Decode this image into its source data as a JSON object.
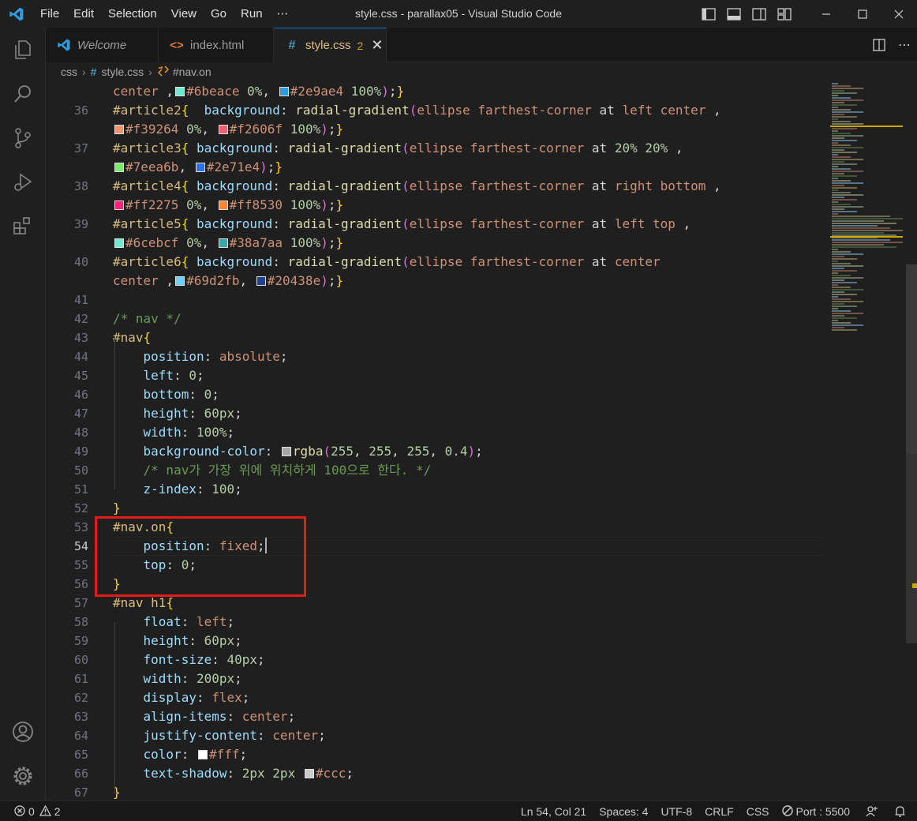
{
  "window": {
    "title": "style.css - parallax05 - Visual Studio Code",
    "menu": [
      "File",
      "Edit",
      "Selection",
      "View",
      "Go",
      "Run",
      "⋯"
    ]
  },
  "activity_icons": [
    "explorer-icon",
    "search-icon",
    "source-control-icon",
    "run-debug-icon",
    "extensions-icon",
    "account-icon",
    "settings-gear-icon"
  ],
  "tabs": [
    {
      "label": "Welcome",
      "icon": "vscode-logo-icon"
    },
    {
      "label": "index.html",
      "icon": "html-icon"
    },
    {
      "label": "style.css",
      "icon": "css-icon",
      "badge": "2",
      "active": true
    }
  ],
  "breadcrumb": {
    "folder": "css",
    "file": "style.css",
    "symbol": "#nav.on"
  },
  "lines": [
    {
      "n": "",
      "t": [
        [
          "val",
          "center"
        ],
        [
          "pun",
          " ,"
        ],
        [
          "sw",
          "#6beace"
        ],
        [
          "val",
          "#6beace"
        ],
        [
          "pun",
          " "
        ],
        [
          "num",
          "0%"
        ],
        [
          "pun",
          ", "
        ],
        [
          "sw",
          "#2e9ae4"
        ],
        [
          "val",
          "#2e9ae4"
        ],
        [
          "pun",
          " "
        ],
        [
          "num",
          "100%"
        ],
        [
          "br2",
          ")"
        ],
        [
          "pun",
          ";"
        ],
        [
          "br1",
          "}"
        ]
      ]
    },
    {
      "n": "36",
      "t": [
        [
          "sel",
          "#article2"
        ],
        [
          "br1",
          "{"
        ],
        [
          "pun",
          "  "
        ],
        [
          "prop",
          "background"
        ],
        [
          "pun",
          ": "
        ],
        [
          "fn",
          "radial-gradient"
        ],
        [
          "br2",
          "("
        ],
        [
          "val",
          "ellipse farthest-corner"
        ],
        [
          "pun",
          " at "
        ],
        [
          "val",
          "left center"
        ],
        [
          "pun",
          " ,"
        ]
      ]
    },
    {
      "n": "",
      "t": [
        [
          "sw",
          "#f39264"
        ],
        [
          "val",
          "#f39264"
        ],
        [
          "pun",
          " "
        ],
        [
          "num",
          "0%"
        ],
        [
          "pun",
          ", "
        ],
        [
          "sw",
          "#f2606f"
        ],
        [
          "val",
          "#f2606f"
        ],
        [
          "pun",
          " "
        ],
        [
          "num",
          "100%"
        ],
        [
          "br2",
          ")"
        ],
        [
          "pun",
          ";"
        ],
        [
          "br1",
          "}"
        ]
      ]
    },
    {
      "n": "37",
      "t": [
        [
          "sel",
          "#article3"
        ],
        [
          "br1",
          "{"
        ],
        [
          "pun",
          " "
        ],
        [
          "prop",
          "background"
        ],
        [
          "pun",
          ": "
        ],
        [
          "fn",
          "radial-gradient"
        ],
        [
          "br2",
          "("
        ],
        [
          "val",
          "ellipse farthest-corner"
        ],
        [
          "pun",
          " at "
        ],
        [
          "num",
          "20% 20%"
        ],
        [
          "pun",
          " ,"
        ]
      ]
    },
    {
      "n": "",
      "t": [
        [
          "sw",
          "#7eea6b"
        ],
        [
          "val",
          "#7eea6b"
        ],
        [
          "pun",
          ", "
        ],
        [
          "sw",
          "#2e71e4"
        ],
        [
          "val",
          "#2e71e4"
        ],
        [
          "br2",
          ")"
        ],
        [
          "pun",
          ";"
        ],
        [
          "br1",
          "}"
        ]
      ]
    },
    {
      "n": "38",
      "t": [
        [
          "sel",
          "#article4"
        ],
        [
          "br1",
          "{"
        ],
        [
          "pun",
          " "
        ],
        [
          "prop",
          "background"
        ],
        [
          "pun",
          ": "
        ],
        [
          "fn",
          "radial-gradient"
        ],
        [
          "br2",
          "("
        ],
        [
          "val",
          "ellipse farthest-corner"
        ],
        [
          "pun",
          " at "
        ],
        [
          "val",
          "right bottom"
        ],
        [
          "pun",
          " ,"
        ]
      ]
    },
    {
      "n": "",
      "t": [
        [
          "sw",
          "#ff2275"
        ],
        [
          "val",
          "#ff2275"
        ],
        [
          "pun",
          " "
        ],
        [
          "num",
          "0%"
        ],
        [
          "pun",
          ", "
        ],
        [
          "sw",
          "#ff8530"
        ],
        [
          "val",
          "#ff8530"
        ],
        [
          "pun",
          " "
        ],
        [
          "num",
          "100%"
        ],
        [
          "br2",
          ")"
        ],
        [
          "pun",
          ";"
        ],
        [
          "br1",
          "}"
        ]
      ]
    },
    {
      "n": "39",
      "t": [
        [
          "sel",
          "#article5"
        ],
        [
          "br1",
          "{"
        ],
        [
          "pun",
          " "
        ],
        [
          "prop",
          "background"
        ],
        [
          "pun",
          ": "
        ],
        [
          "fn",
          "radial-gradient"
        ],
        [
          "br2",
          "("
        ],
        [
          "val",
          "ellipse farthest-corner"
        ],
        [
          "pun",
          " at "
        ],
        [
          "val",
          "left top"
        ],
        [
          "pun",
          " ,"
        ]
      ]
    },
    {
      "n": "",
      "t": [
        [
          "sw",
          "#6cebcf"
        ],
        [
          "val",
          "#6cebcf"
        ],
        [
          "pun",
          " "
        ],
        [
          "num",
          "0%"
        ],
        [
          "pun",
          ", "
        ],
        [
          "sw",
          "#38a7aa"
        ],
        [
          "val",
          "#38a7aa"
        ],
        [
          "pun",
          " "
        ],
        [
          "num",
          "100%"
        ],
        [
          "br2",
          ")"
        ],
        [
          "pun",
          ";"
        ],
        [
          "br1",
          "}"
        ]
      ]
    },
    {
      "n": "40",
      "t": [
        [
          "sel",
          "#article6"
        ],
        [
          "br1",
          "{"
        ],
        [
          "pun",
          " "
        ],
        [
          "prop",
          "background"
        ],
        [
          "pun",
          ": "
        ],
        [
          "fn",
          "radial-gradient"
        ],
        [
          "br2",
          "("
        ],
        [
          "val",
          "ellipse farthest-corner"
        ],
        [
          "pun",
          " at "
        ],
        [
          "val",
          "center"
        ]
      ]
    },
    {
      "n": "",
      "t": [
        [
          "val",
          "center"
        ],
        [
          "pun",
          " ,"
        ],
        [
          "sw",
          "#69d2fb"
        ],
        [
          "val",
          "#69d2fb"
        ],
        [
          "pun",
          ", "
        ],
        [
          "sw",
          "#20438e"
        ],
        [
          "val",
          "#20438e"
        ],
        [
          "br2",
          ")"
        ],
        [
          "pun",
          ";"
        ],
        [
          "br1",
          "}"
        ]
      ]
    },
    {
      "n": "41",
      "t": []
    },
    {
      "n": "42",
      "t": [
        [
          "cmt",
          "/* nav */"
        ]
      ]
    },
    {
      "n": "43",
      "t": [
        [
          "sel",
          "#nav"
        ],
        [
          "br1",
          "{"
        ]
      ]
    },
    {
      "n": "44",
      "t": [
        [
          "pun",
          "    "
        ],
        [
          "prop",
          "position"
        ],
        [
          "pun",
          ": "
        ],
        [
          "val",
          "absolute"
        ],
        [
          "pun",
          ";"
        ]
      ]
    },
    {
      "n": "45",
      "t": [
        [
          "pun",
          "    "
        ],
        [
          "prop",
          "left"
        ],
        [
          "pun",
          ": "
        ],
        [
          "num",
          "0"
        ],
        [
          "pun",
          ";"
        ]
      ]
    },
    {
      "n": "46",
      "t": [
        [
          "pun",
          "    "
        ],
        [
          "prop",
          "bottom"
        ],
        [
          "pun",
          ": "
        ],
        [
          "num",
          "0"
        ],
        [
          "pun",
          ";"
        ]
      ]
    },
    {
      "n": "47",
      "t": [
        [
          "pun",
          "    "
        ],
        [
          "prop",
          "height"
        ],
        [
          "pun",
          ": "
        ],
        [
          "num",
          "60px"
        ],
        [
          "pun",
          ";"
        ]
      ]
    },
    {
      "n": "48",
      "t": [
        [
          "pun",
          "    "
        ],
        [
          "prop",
          "width"
        ],
        [
          "pun",
          ": "
        ],
        [
          "num",
          "100%"
        ],
        [
          "pun",
          ";"
        ]
      ]
    },
    {
      "n": "49",
      "t": [
        [
          "pun",
          "    "
        ],
        [
          "prop",
          "background-color"
        ],
        [
          "pun",
          ": "
        ],
        [
          "sw",
          "#a6a6a6"
        ],
        [
          "fn",
          "rgba"
        ],
        [
          "br2",
          "("
        ],
        [
          "num",
          "255"
        ],
        [
          "pun",
          ", "
        ],
        [
          "num",
          "255"
        ],
        [
          "pun",
          ", "
        ],
        [
          "num",
          "255"
        ],
        [
          "pun",
          ", "
        ],
        [
          "num",
          "0.4"
        ],
        [
          "br2",
          ")"
        ],
        [
          "pun",
          ";"
        ]
      ]
    },
    {
      "n": "50",
      "t": [
        [
          "pun",
          "    "
        ],
        [
          "cmt",
          "/* nav가 가장 위에 위치하게 100으로 한다. */"
        ]
      ]
    },
    {
      "n": "51",
      "t": [
        [
          "pun",
          "    "
        ],
        [
          "prop",
          "z-index"
        ],
        [
          "pun",
          ": "
        ],
        [
          "num",
          "100"
        ],
        [
          "pun",
          ";"
        ]
      ]
    },
    {
      "n": "52",
      "t": [
        [
          "br1",
          "}"
        ]
      ]
    },
    {
      "n": "53",
      "t": [
        [
          "sel",
          "#nav.on"
        ],
        [
          "br1",
          "{"
        ]
      ]
    },
    {
      "n": "54",
      "t": [
        [
          "pun",
          "    "
        ],
        [
          "prop",
          "position"
        ],
        [
          "pun",
          ": "
        ],
        [
          "val",
          "fixed"
        ],
        [
          "pun",
          ";"
        ],
        [
          "caret",
          ""
        ]
      ],
      "current": true
    },
    {
      "n": "55",
      "t": [
        [
          "pun",
          "    "
        ],
        [
          "prop",
          "top"
        ],
        [
          "pun",
          ": "
        ],
        [
          "num",
          "0"
        ],
        [
          "pun",
          ";"
        ]
      ]
    },
    {
      "n": "56",
      "t": [
        [
          "br1",
          "}"
        ]
      ]
    },
    {
      "n": "57",
      "t": [
        [
          "sel",
          "#nav h1"
        ],
        [
          "br1",
          "{"
        ]
      ]
    },
    {
      "n": "58",
      "t": [
        [
          "pun",
          "    "
        ],
        [
          "prop",
          "float"
        ],
        [
          "pun",
          ": "
        ],
        [
          "val",
          "left"
        ],
        [
          "pun",
          ";"
        ]
      ]
    },
    {
      "n": "59",
      "t": [
        [
          "pun",
          "    "
        ],
        [
          "prop",
          "height"
        ],
        [
          "pun",
          ": "
        ],
        [
          "num",
          "60px"
        ],
        [
          "pun",
          ";"
        ]
      ]
    },
    {
      "n": "60",
      "t": [
        [
          "pun",
          "    "
        ],
        [
          "prop",
          "font-size"
        ],
        [
          "pun",
          ": "
        ],
        [
          "num",
          "40px"
        ],
        [
          "pun",
          ";"
        ]
      ]
    },
    {
      "n": "61",
      "t": [
        [
          "pun",
          "    "
        ],
        [
          "prop",
          "width"
        ],
        [
          "pun",
          ": "
        ],
        [
          "num",
          "200px"
        ],
        [
          "pun",
          ";"
        ]
      ]
    },
    {
      "n": "62",
      "t": [
        [
          "pun",
          "    "
        ],
        [
          "prop",
          "display"
        ],
        [
          "pun",
          ": "
        ],
        [
          "val",
          "flex"
        ],
        [
          "pun",
          ";"
        ]
      ]
    },
    {
      "n": "63",
      "t": [
        [
          "pun",
          "    "
        ],
        [
          "prop",
          "align-items"
        ],
        [
          "pun",
          ": "
        ],
        [
          "val",
          "center"
        ],
        [
          "pun",
          ";"
        ]
      ]
    },
    {
      "n": "64",
      "t": [
        [
          "pun",
          "    "
        ],
        [
          "prop",
          "justify-content"
        ],
        [
          "pun",
          ": "
        ],
        [
          "val",
          "center"
        ],
        [
          "pun",
          ";"
        ]
      ]
    },
    {
      "n": "65",
      "t": [
        [
          "pun",
          "    "
        ],
        [
          "prop",
          "color"
        ],
        [
          "pun",
          ": "
        ],
        [
          "sw",
          "#ffffff"
        ],
        [
          "val",
          "#fff"
        ],
        [
          "pun",
          ";"
        ]
      ]
    },
    {
      "n": "66",
      "t": [
        [
          "pun",
          "    "
        ],
        [
          "prop",
          "text-shadow"
        ],
        [
          "pun",
          ": "
        ],
        [
          "num",
          "2px 2px"
        ],
        [
          "pun",
          " "
        ],
        [
          "sw",
          "#cccccc"
        ],
        [
          "val",
          "#ccc"
        ],
        [
          "pun",
          ";"
        ]
      ]
    },
    {
      "n": "67",
      "t": [
        [
          "br1",
          "}"
        ]
      ]
    }
  ],
  "status": {
    "errors": "0",
    "warnings": "2",
    "position": "Ln 54, Col 21",
    "spaces": "Spaces: 4",
    "encoding": "UTF-8",
    "eol": "CRLF",
    "language": "CSS",
    "port": "Port : 5500"
  },
  "colors": {
    "accent": "#0078d4",
    "highlight_box": "#e51a1a",
    "background": "#1f1f1f"
  }
}
